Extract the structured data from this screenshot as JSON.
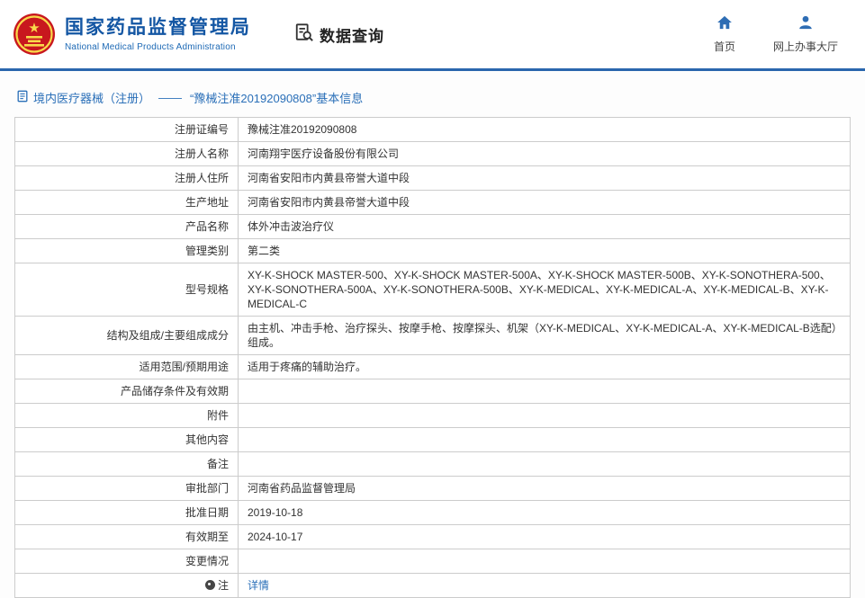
{
  "header": {
    "org_name_cn": "国家药品监督管理局",
    "org_name_en": "National Medical Products Administration",
    "section_title": "数据查询",
    "nav_home": "首页",
    "nav_service_hall": "网上办事大厅"
  },
  "breadcrumb": {
    "category": "境内医疗器械（注册）",
    "dash": "——",
    "title": "“豫械注准20192090808”基本信息"
  },
  "accent_colors": {
    "header_blue": "#1356a3",
    "divider_blue": "#2a66ad",
    "link_blue": "#2a6fb8",
    "emblem_red": "#c8171e",
    "emblem_gold": "#f9d94a"
  },
  "table": {
    "rows": [
      {
        "label": "注册证编号",
        "value": "豫械注准20192090808"
      },
      {
        "label": "注册人名称",
        "value": "河南翔宇医疗设备股份有限公司"
      },
      {
        "label": "注册人住所",
        "value": "河南省安阳市内黄县帝誉大道中段"
      },
      {
        "label": "生产地址",
        "value": "河南省安阳市内黄县帝誉大道中段"
      },
      {
        "label": "产品名称",
        "value": "体外冲击波治疗仪"
      },
      {
        "label": "管理类别",
        "value": "第二类"
      },
      {
        "label": "型号规格",
        "value": "XY-K-SHOCK MASTER-500、XY-K-SHOCK MASTER-500A、XY-K-SHOCK MASTER-500B、XY-K-SONOTHERA-500、XY-K-SONOTHERA-500A、XY-K-SONOTHERA-500B、XY-K-MEDICAL、XY-K-MEDICAL-A、XY-K-MEDICAL-B、XY-K-MEDICAL-C"
      },
      {
        "label": "结构及组成/主要组成成分",
        "value": "由主机、冲击手枪、治疗探头、按摩手枪、按摩探头、机架（XY-K-MEDICAL、XY-K-MEDICAL-A、XY-K-MEDICAL-B选配）组成。"
      },
      {
        "label": "适用范围/预期用途",
        "value": "适用于疼痛的辅助治疗。"
      },
      {
        "label": "产品储存条件及有效期",
        "value": ""
      },
      {
        "label": "附件",
        "value": ""
      },
      {
        "label": "其他内容",
        "value": ""
      },
      {
        "label": "备注",
        "value": ""
      },
      {
        "label": "审批部门",
        "value": "河南省药品监督管理局"
      },
      {
        "label": "批准日期",
        "value": "2019-10-18"
      },
      {
        "label": "有效期至",
        "value": "2024-10-17"
      },
      {
        "label": "变更情况",
        "value": ""
      },
      {
        "label": "注",
        "value": "详情"
      }
    ]
  }
}
